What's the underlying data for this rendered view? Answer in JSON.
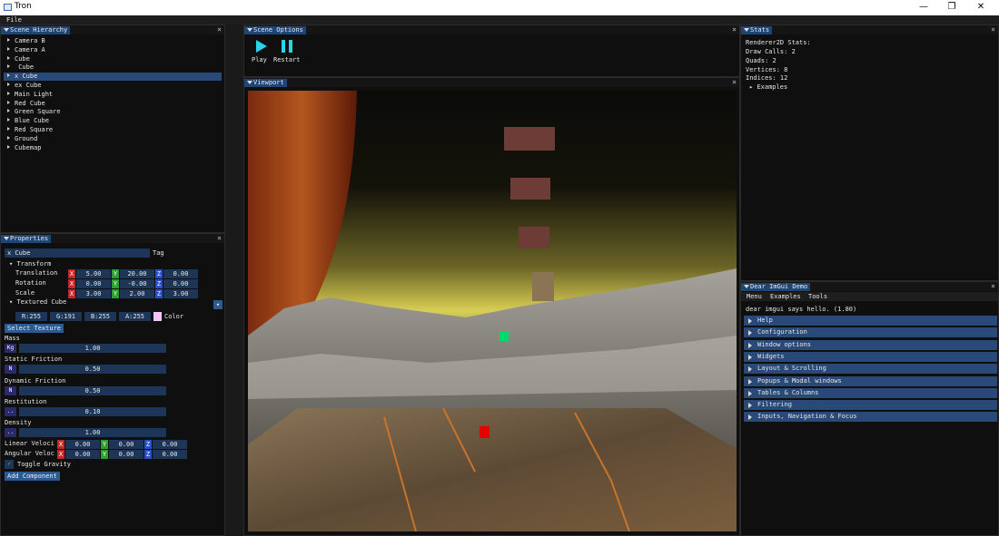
{
  "window": {
    "title": "Tron",
    "minimize": "—",
    "maximize": "❐",
    "close": "✕"
  },
  "menubar": {
    "file": "File"
  },
  "hierarchy": {
    "title": "Scene Hierarchy",
    "items": [
      "Camera B",
      "Camera A",
      "Cube",
      " Cube",
      "x Cube",
      "ex Cube",
      "Main Light",
      "Red Cube",
      "Green Square",
      "Blue Cube",
      "Red Square",
      "Ground",
      "Cubemap"
    ],
    "selected_index": 4
  },
  "properties": {
    "title": "Properties",
    "name_value": "x Cube",
    "tag_label": "Tag",
    "transform_label": "Transform",
    "translation_label": "Translation",
    "rotation_label": "Rotation",
    "scale_label": "Scale",
    "translation": [
      "5.00",
      "20.00",
      "0.00"
    ],
    "rotation": [
      "0.00",
      "-0.00",
      "0.00"
    ],
    "scale": [
      "3.00",
      "2.00",
      "3.00"
    ],
    "axis_x": "X",
    "axis_y": "Y",
    "axis_z": "Z",
    "textured_cube_label": "Textured Cube",
    "color_r": "R:255",
    "color_g": "G:191",
    "color_b": "B:255",
    "color_a": "A:255",
    "color_label": "Color",
    "color_swatch": "#f7c3f7",
    "select_texture": "Select Texture",
    "mass_label": "Mass",
    "mass_unit": "Kg",
    "mass_value": "1.00",
    "static_friction_label": "Static Friction",
    "static_friction_unit": "N",
    "static_friction_value": "0.50",
    "dynamic_friction_label": "Dynamic Friction",
    "dynamic_friction_unit": "N",
    "dynamic_friction_value": "0.50",
    "restitution_label": "Restitution",
    "restitution_unit": "..",
    "restitution_value": "0.10",
    "density_label": "Density",
    "density_unit": "..",
    "density_value": "1.00",
    "linear_label": "Linear Veloci",
    "linear": [
      "0.00",
      "0.00",
      "0.00"
    ],
    "angular_label": "Angular Veloc",
    "angular": [
      "0.00",
      "0.00",
      "0.00"
    ],
    "toggle_gravity": "Toggle Gravity",
    "add_component": "Add Component"
  },
  "scene_options": {
    "title": "Scene Options",
    "play": "Play",
    "restart": "Restart"
  },
  "viewport": {
    "title": "Viewport"
  },
  "stats": {
    "title": "Stats",
    "header": "Renderer2D Stats:",
    "draw_calls": "Draw Calls: 2",
    "quads": "Quads: 2",
    "vertices": "Vertices: 8",
    "indices": "Indices: 12",
    "examples": "Examples"
  },
  "demo": {
    "title": "Dear ImGui Demo",
    "menu_menu": "Menu",
    "menu_examples": "Examples",
    "menu_tools": "Tools",
    "hello": "dear imgui says hello. (1.80)",
    "sections": [
      "Help",
      "Configuration",
      "Window options",
      "Widgets",
      "Layout & Scrolling",
      "Popups & Modal windows",
      "Tables & Columns",
      "Filtering",
      "Inputs, Navigation & Focus"
    ]
  },
  "colors": {
    "accent": "#1f4574",
    "play_icon": "#29d3e8",
    "header_bg": "#294a78"
  }
}
